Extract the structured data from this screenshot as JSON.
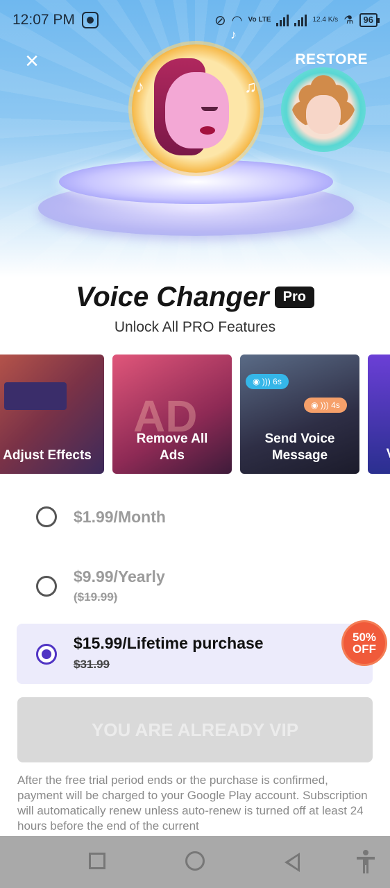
{
  "status_bar": {
    "time": "12:07 PM",
    "network_label": "Vo LTE",
    "speed": "12.4 K/s",
    "battery": "96"
  },
  "header": {
    "close_icon": "close-icon",
    "restore_label": "RESTORE"
  },
  "title": {
    "app_name": "Voice Changer",
    "badge": "Pro",
    "subtitle": "Unlock All PRO Features"
  },
  "features": [
    {
      "label": "Adjust Effects",
      "icon": "equalizer-image"
    },
    {
      "label": "Remove All Ads",
      "icon": "ad-crossed-image"
    },
    {
      "label": "Send Voice Message",
      "icon": "voice-message-image"
    },
    {
      "label": "V",
      "icon": "partial-card"
    }
  ],
  "voice_bubbles": [
    "6s",
    "4s"
  ],
  "plans": [
    {
      "price": "$1.99/Month",
      "old_price": "",
      "selected": false
    },
    {
      "price": "$9.99/Yearly",
      "old_price": "($19.99)",
      "selected": false
    },
    {
      "price": "$15.99/Lifetime purchase",
      "old_price": "$31.99",
      "selected": true,
      "badge": "50% OFF"
    }
  ],
  "vip_button": "YOU ARE ALREADY VIP",
  "disclaimer": "After the free trial period ends or the purchase is confirmed, payment will be charged to your Google Play account. Subscription will automatically renew unless auto-renew is turned off at least 24 hours before the end of the current",
  "colors": {
    "accent": "#5034c4",
    "selected_bg": "#ecebfb",
    "badge": "#f05a3a",
    "disabled_button": "#d9d9d9"
  }
}
